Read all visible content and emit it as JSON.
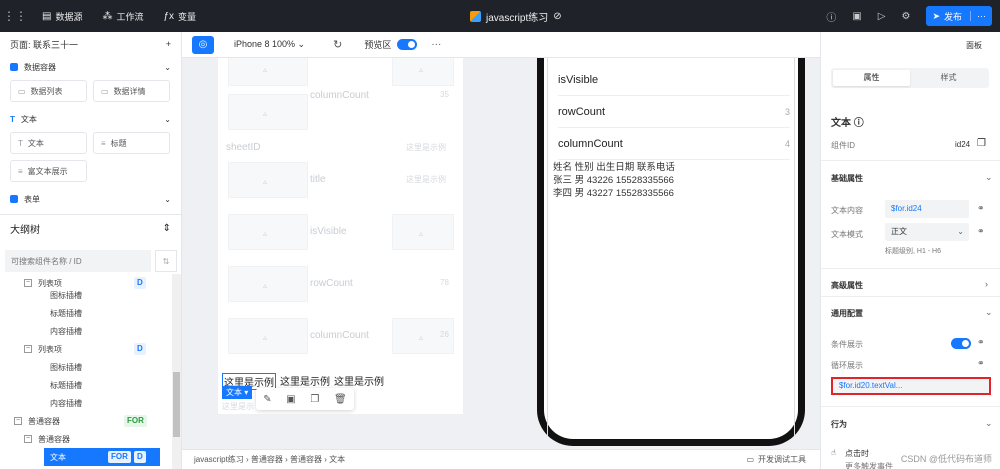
{
  "topbar": {
    "menu": [
      {
        "icon": "database-icon",
        "glyph": "▤",
        "label": "数据源"
      },
      {
        "icon": "workflow-icon",
        "glyph": "⁂",
        "label": "工作流"
      },
      {
        "icon": "function-icon",
        "glyph": "ƒx",
        "label": "变量"
      }
    ],
    "app_title": "javascript练习",
    "publish_label": "发布",
    "publish_more": "···"
  },
  "left": {
    "page_selector": "页面: 联系三十一",
    "add_page": "+",
    "sections": [
      {
        "title": "数据容器",
        "items": [
          "数据列表",
          "数据详情"
        ]
      },
      {
        "title": "文本",
        "items": [
          "文本",
          "标题",
          "富文本展示"
        ]
      },
      {
        "title": "表单",
        "items": []
      }
    ],
    "outline_title": "大纲树",
    "search_placeholder": "可搜索组件名称 / ID",
    "tree": [
      {
        "label": "列表项",
        "tag": "D"
      },
      {
        "label": "图标插槽"
      },
      {
        "label": "标题插槽"
      },
      {
        "label": "内容插槽"
      },
      {
        "label": "列表项",
        "tag": "D"
      },
      {
        "label": "图标插槽"
      },
      {
        "label": "标题插槽"
      },
      {
        "label": "内容插槽"
      },
      {
        "label": "普通容器",
        "tag": "FOR"
      },
      {
        "label": "普通容器"
      },
      {
        "label": "文本",
        "tag": "FOR",
        "tag2": "D"
      }
    ]
  },
  "canvas_toolbar": {
    "device": "iPhone 8 100% ⌄",
    "preview_label": "预览区",
    "more": "···"
  },
  "design": {
    "ghost_labels": [
      "columnCount",
      "sheetID",
      "title",
      "isVisible",
      "rowCount",
      "columnCount"
    ],
    "ghost_values": [
      "35",
      "这里是示例",
      "这里是示例",
      "78",
      "26"
    ],
    "sample_texts": [
      "这里是示例",
      "这里是示例",
      "这里是示例"
    ],
    "text_tag": "文本",
    "ghost_footer": "这里是示"
  },
  "phone": {
    "rows": [
      {
        "label": "isVisible",
        "value": ""
      },
      {
        "label": "rowCount",
        "value": "3"
      },
      {
        "label": "columnCount",
        "value": "4"
      }
    ],
    "table_lines": [
      "姓名 性别 出生日期 联系电话",
      "张三 男 43226 15528335566",
      "李四 男 43227 15528335566"
    ]
  },
  "bottombar": {
    "breadcrumb": "javascript练习  ›  普通容器  ›  普通容器  ›  文本",
    "debug_label": "开发调试工具"
  },
  "right": {
    "panel_label": "面板",
    "tabs": [
      "属性",
      "样式"
    ],
    "component_type": "文本 ⓘ",
    "component_id_label": "组件ID",
    "component_id": "id24",
    "basic_props": "基础属性",
    "text_content_label": "文本内容",
    "text_content_value": "$for.id24",
    "text_mode_label": "文本模式",
    "text_mode_value": "正文",
    "text_mode_hint": "标题级别, H1 - H6",
    "advanced_props": "高级属性",
    "general_config": "通用配置",
    "condition_label": "条件展示",
    "loop_label": "循环展示",
    "loop_value": "$for.id20.textVal...",
    "behavior": "行为",
    "on_click": "点击时",
    "more_events": "更多触发事件"
  },
  "watermark": "CSDN @低代码布道师"
}
